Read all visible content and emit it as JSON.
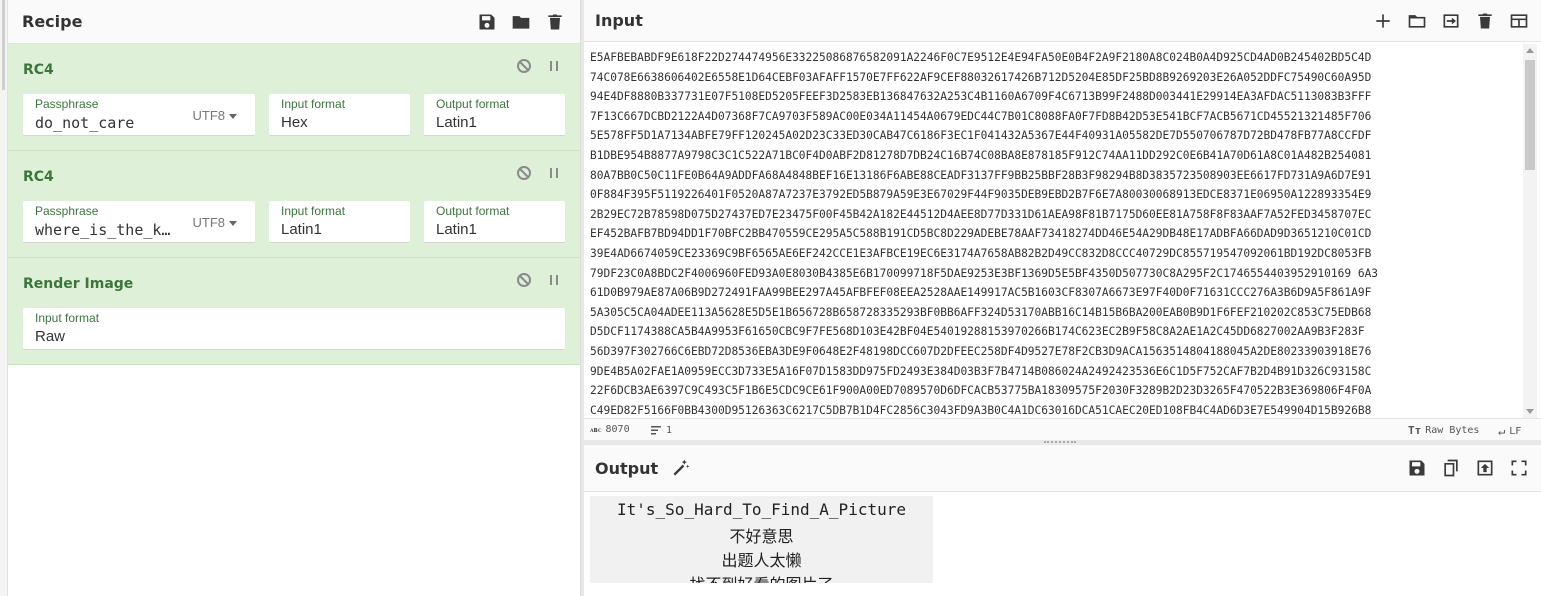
{
  "recipe": {
    "title": "Recipe",
    "icons": [
      "save-icon",
      "folder-icon",
      "trash-icon"
    ],
    "operations": [
      {
        "name": "RC4",
        "fields": [
          {
            "label": "Passphrase",
            "value": "do_not_care",
            "encoding": "UTF8"
          },
          {
            "label": "Input format",
            "value": "Hex"
          },
          {
            "label": "Output format",
            "value": "Latin1"
          }
        ]
      },
      {
        "name": "RC4",
        "fields": [
          {
            "label": "Passphrase",
            "value": "where_is_the_k…",
            "encoding": "UTF8"
          },
          {
            "label": "Input format",
            "value": "Latin1"
          },
          {
            "label": "Output format",
            "value": "Latin1"
          }
        ]
      },
      {
        "name": "Render Image",
        "fields": [
          {
            "label": "Input format",
            "value": "Raw"
          }
        ]
      }
    ]
  },
  "input": {
    "title": "Input",
    "lines": [
      "E5AFBEBABDF9E618F22D274474956E33225086876582091A2246F0C7E9512E4E94FA50E0B4F2A9F2180A8C024B0A4D925CD4AD0B245402BD5C4D",
      "74C078E6638606402E6558E1D64CEBF03AFAFF1570E7FF622AF9CEF88032617426B712D5204E85DF25BD8B9269203E26A052DDFC75490C60A95D",
      "94E4DF8880B337731E07F5108ED5205FEEF3D2583EB136847632A253C4B1160A6709F4C6713B99F2488D003441E29914EA3AFDAC5113083B3FFF",
      "7F13C667DCBD2122A4D07368F7CA9703F589AC00E034A11454A0679EDC44C7B01C8088FA0F7FD8B42D53E541BCF7ACB5671CD45521321485F706",
      "5E578FF5D1A7134ABFE79FF120245A02D23C33ED30CAB47C6186F3EC1F041432A5367E44F40931A05582DE7D550706787D72BD478FB77A8CCFDF",
      "B1DBE954B8877A9798C3C1C522A71BC0F4D0ABF2D81278D7DB24C16B74C08BA8E878185F912C74AA11DD292C0E6B41A70D61A8C01A482B254081",
      "80A7BB0C50C11FE0B64A9ADDFA68A4848BEF16E13186F6ABE88CEADF3137FF9BB25BBF28B3F98294B8D3835723508903EE6617FD731A9A6D7E91",
      "0F884F395F5119226401F0520A87A7237E3792ED5B879A59E3E67029F44F9035DEB9EBD2B7F6E7A80030068913EDCE8371E06950A122893354E9",
      "2B29EC72B78598D075D27437ED7E23475F00F45B42A182E44512D4AEE8D77D331D61AEA98F81B7175D60EE81A758F8F83AAF7A52FED3458707EC",
      "EF452BAFB7BD94DD1F70BFC2BB470559CE295A5C588B191CD5BC8D229ADEBE78AAF73418274DD46E54A29DB48E17ADBFA66DAD9D3651210C01CD",
      "39E4AD6674059CE23369C9BF6565AE6EF242CCE1E3AFBCE19EC6E3174A7658AB82B2D49CC832D8CCC40729DC855719547092061BD192DC8053FB",
      "79DF23C0A8BDC2F4006960FED93A0E8030B4385E6B170099718F5DAE9253E3BF1369D5E5BF4350D507730C8A295F2C1746554403952910169 6A3",
      "61D0B979AE87A06B9D272491FAA99BEE297A45AFBFEF08EEA2528AAE149917AC5B1603CF8307A6673E97F40D0F71631CCC276A3B6D9A5F861A9F",
      "5A305C5CA04ADEE113A5628E5D5E1B656728B658728335293BF0BB6AFF324D53170ABB16C14B15B6BA200EAB0B9D1F6FEF210202C853C75EDB68",
      "D5DCF1174388CA5B4A9953F61650CBC9F7FE568D103E42BF04E54019288153970266B174C623EC2B9F58C8A2AE1A2C45DD6827002AA9B3F283F",
      "56D397F302766C6EBD72D8536EBA3DE9F0648E2F48198DCC607D2DFEEC258DF4D9527E78F2CB3D9ACA1563514804188045A2DE80233903918E76",
      "9DE4B5A02FAE1A0959ECC3D733E5A16F07D1583DD975FD2493E384D03B3F7B4714B086024A2492423536E6C1D5F752CAF7B2D4B91D326C93158C",
      "22F6DCB3AE6397C9C493C5F1B6E5CDC9CE61F900A00ED7089570D6DFCACB53775BA18309575F2030F3289B2D23D3265F470522B3E369806F4F0A",
      "C49ED82F5166F0BB4300D95126363C6217C5DB7B1D4FC2856C3043FD9A3B0C4A1DC63016DCA51CAEC20ED108FB4C4AD6D3E7E549904D15B926B8"
    ],
    "status": {
      "length": "8070",
      "lines": "1",
      "encoding": "Raw Bytes",
      "eol": "LF"
    },
    "icons": [
      "plus-icon",
      "open-folder-icon",
      "import-icon",
      "trash-icon",
      "layout-icon"
    ]
  },
  "output": {
    "title": "Output",
    "image_text": [
      "It's_So_Hard_To_Find_A_Picture",
      "不好意思",
      "出题人太懒",
      "找不到好看的图片了"
    ],
    "icons": [
      "magic-wand-icon",
      "save-icon",
      "copy-icon",
      "move-to-input-icon",
      "fullscreen-icon"
    ]
  }
}
